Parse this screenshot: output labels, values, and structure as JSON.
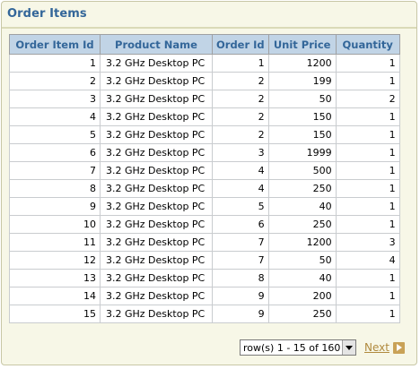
{
  "region": {
    "title": "Order Items"
  },
  "table": {
    "columns": [
      "Order Item Id",
      "Product Name",
      "Order Id",
      "Unit Price",
      "Quantity"
    ],
    "rows": [
      [
        "1",
        "3.2 GHz Desktop PC",
        "1",
        "1200",
        "1"
      ],
      [
        "2",
        "3.2 GHz Desktop PC",
        "2",
        "199",
        "1"
      ],
      [
        "3",
        "3.2 GHz Desktop PC",
        "2",
        "50",
        "2"
      ],
      [
        "4",
        "3.2 GHz Desktop PC",
        "2",
        "150",
        "1"
      ],
      [
        "5",
        "3.2 GHz Desktop PC",
        "2",
        "150",
        "1"
      ],
      [
        "6",
        "3.2 GHz Desktop PC",
        "3",
        "1999",
        "1"
      ],
      [
        "7",
        "3.2 GHz Desktop PC",
        "4",
        "500",
        "1"
      ],
      [
        "8",
        "3.2 GHz Desktop PC",
        "4",
        "250",
        "1"
      ],
      [
        "9",
        "3.2 GHz Desktop PC",
        "5",
        "40",
        "1"
      ],
      [
        "10",
        "3.2 GHz Desktop PC",
        "6",
        "250",
        "1"
      ],
      [
        "11",
        "3.2 GHz Desktop PC",
        "7",
        "1200",
        "3"
      ],
      [
        "12",
        "3.2 GHz Desktop PC",
        "7",
        "50",
        "4"
      ],
      [
        "13",
        "3.2 GHz Desktop PC",
        "8",
        "40",
        "1"
      ],
      [
        "14",
        "3.2 GHz Desktop PC",
        "9",
        "200",
        "1"
      ],
      [
        "15",
        "3.2 GHz Desktop PC",
        "9",
        "250",
        "1"
      ]
    ]
  },
  "pagination": {
    "range_selected": "row(s) 1 - 15 of 160",
    "next_label": "Next",
    "next_icon": "arrow-right-icon",
    "dropdown_icon": "chevron-down-icon"
  },
  "colors": {
    "region_bg": "#f7f7e7",
    "region_border": "#c8c7a6",
    "title": "#336699",
    "header_bg": "#c1d4e6",
    "link": "#b08a3e"
  }
}
